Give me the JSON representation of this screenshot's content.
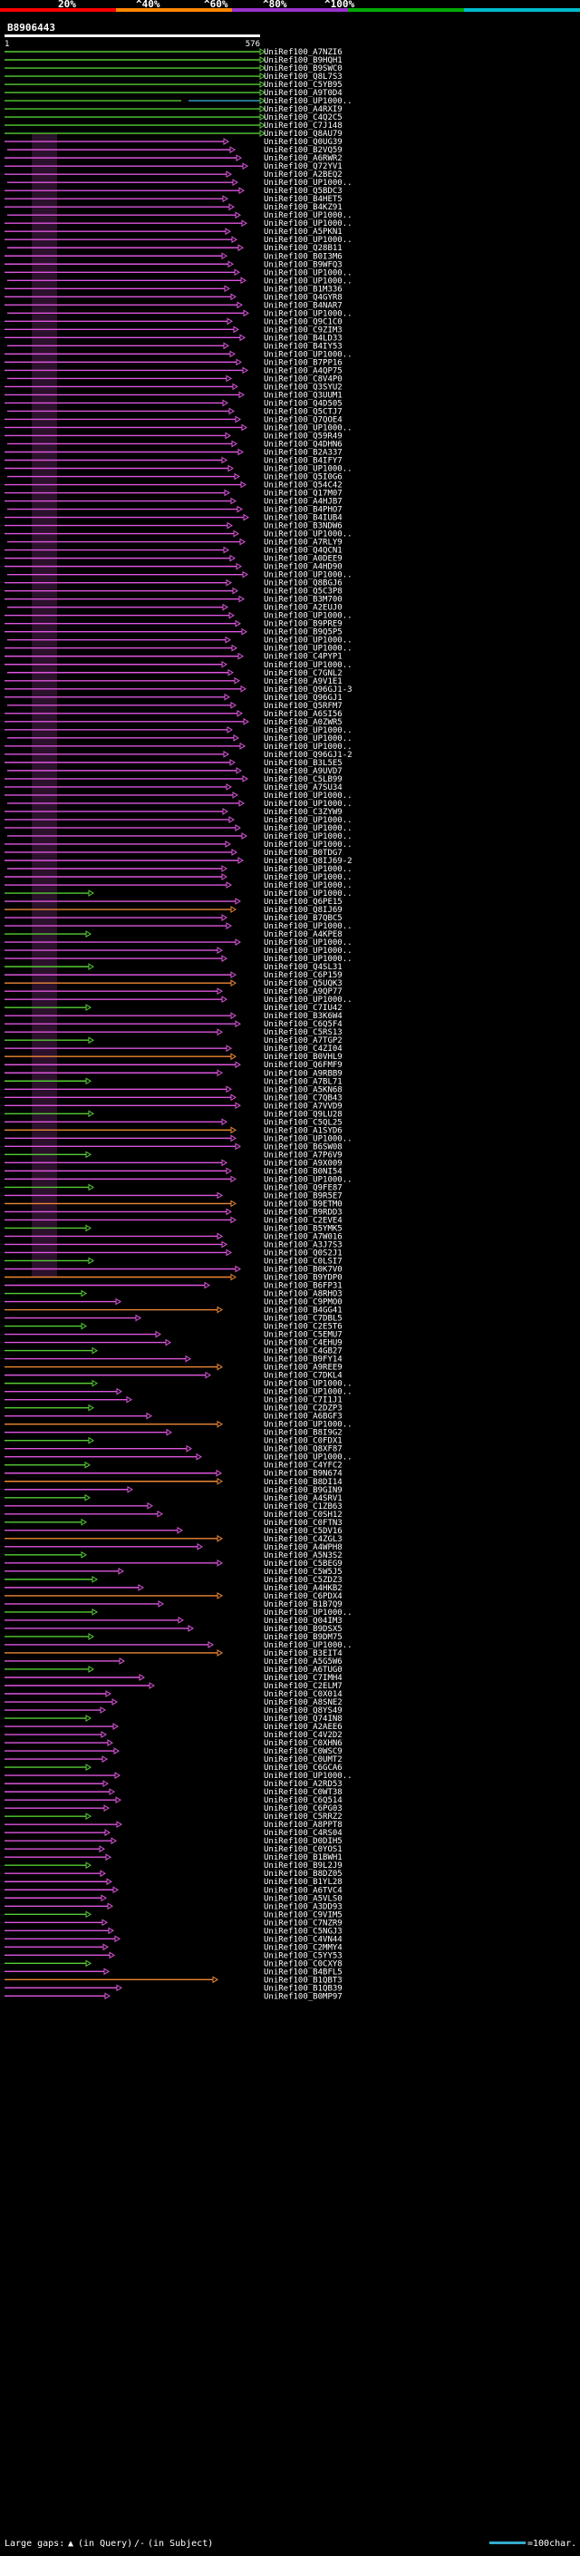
{
  "query_id": "B8906443",
  "ruler": {
    "start": "1",
    "end": "576"
  },
  "scale": {
    "ticks": [
      "20%",
      "^40%",
      "^60%",
      "^80%",
      "^100%"
    ],
    "colors": [
      "#ff0000",
      "#ff8800",
      "#9933cc",
      "#00aa00",
      "#00bbcc"
    ]
  },
  "legend": {
    "large_gaps_label": "Large gaps:",
    "in_query_label": "(in Query)",
    "in_subject_label": "(in Subject)",
    "scale_label": "=100char."
  },
  "colors": {
    "green": "#55cc33",
    "magenta": "#dd55dd",
    "orange": "#ee8833",
    "cyan": "#33aacc",
    "dark_fill": "#4a1c4a"
  },
  "hits": [
    "UniRef100_A7NZI6",
    "UniRef100_B9HQH1",
    "UniRef100_B9SWC0",
    "UniRef100_Q8L7S3",
    "UniRef100_C5YB95",
    "UniRef100_A9T0D4",
    "UniRef100_UP1000..",
    "UniRef100_A4RXI9",
    "UniRef100_C4Q2C5",
    "UniRef100_C7J148",
    "UniRef100_Q8AU79",
    "UniRef100_Q0UG39",
    "UniRef100_B2VQ59",
    "UniRef100_A6RWR2",
    "UniRef100_Q72YV1",
    "UniRef100_A2BEQ2",
    "UniRef100_UP1000..",
    "UniRef100_Q5BDC3",
    "UniRef100_B4HET5",
    "UniRef100_B4KZ91",
    "UniRef100_UP1000..",
    "UniRef100_UP1000..",
    "UniRef100_A5PKN1",
    "UniRef100_UP1000..",
    "UniRef100_Q28B11",
    "UniRef100_B0I3M6",
    "UniRef100_B9WFQ3",
    "UniRef100_UP1000..",
    "UniRef100_UP1000..",
    "UniRef100_B1M336",
    "UniRef100_Q4GYR8",
    "UniRef100_B4NAR7",
    "UniRef100_UP1000..",
    "UniRef100_Q9C1C0",
    "UniRef100_C9ZIM3",
    "UniRef100_B4LD33",
    "UniRef100_B4IY53",
    "UniRef100_UP1000..",
    "UniRef100_B7PP16",
    "UniRef100_A4QP75",
    "UniRef100_C8V4P0",
    "UniRef100_Q3SYU2",
    "UniRef100_Q3UUM1",
    "UniRef100_Q4D505",
    "UniRef100_Q5CTJ7",
    "UniRef100_Q7QOE4",
    "UniRef100_UP1000..",
    "UniRef100_Q59R49",
    "UniRef100_Q4DHN6",
    "UniRef100_B2A337",
    "UniRef100_B4IFY7",
    "UniRef100_UP1000..",
    "UniRef100_Q5I0G6",
    "UniRef100_Q54C42",
    "UniRef100_Q17M07",
    "UniRef100_A4HJB7",
    "UniRef100_B4PHO7",
    "UniRef100_B4IUB4",
    "UniRef100_B3NDW6",
    "UniRef100_UP1000..",
    "UniRef100_A7RLY9",
    "UniRef100_Q4QCN1",
    "UniRef100_A0DEE9",
    "UniRef100_A4HD90",
    "UniRef100_UP1000..",
    "UniRef100_Q8BGJ6",
    "UniRef100_Q5C3P8",
    "UniRef100_B3M700",
    "UniRef100_A2EUJ0",
    "UniRef100_UP1000..",
    "UniRef100_B9PRE9",
    "UniRef100_B9Q5P5",
    "UniRef100_UP1000..",
    "UniRef100_UP1000..",
    "UniRef100_C4PYP1",
    "UniRef100_UP1000..",
    "UniRef100_C7GNL2",
    "UniRef100_A9V1E1",
    "UniRef100_Q96GJ1-3",
    "UniRef100_Q96GJ1",
    "UniRef100_Q5RFM7",
    "UniRef100_A6SI56",
    "UniRef100_A0ZWR5",
    "UniRef100_UP1000..",
    "UniRef100_UP1000..",
    "UniRef100_UP1000..",
    "UniRef100_Q96GJ1-2",
    "UniRef100_B3L5E5",
    "UniRef100_A9UVD7",
    "UniRef100_C5LB99",
    "UniRef100_A7SU34",
    "UniRef100_UP1000..",
    "UniRef100_UP1000..",
    "UniRef100_C3ZYW9",
    "UniRef100_UP1000..",
    "UniRef100_UP1000..",
    "UniRef100_UP1000..",
    "UniRef100_UP1000..",
    "UniRef100_B0TDG7",
    "UniRef100_Q8IJ69-2",
    "UniRef100_UP1000..",
    "UniRef100_UP1000..",
    "UniRef100_UP1000..",
    "UniRef100_UP1000..",
    "UniRef100_Q6PE15",
    "UniRef100_Q8IJ69",
    "UniRef100_B7QBC5",
    "UniRef100_UP1000..",
    "UniRef100_A4KPE8",
    "UniRef100_UP1000..",
    "UniRef100_UP1000..",
    "UniRef100_UP1000..",
    "UniRef100_Q4SL31",
    "UniRef100_C6P159",
    "UniRef100_Q5UQK3",
    "UniRef100_A9QP77",
    "UniRef100_UP1000..",
    "UniRef100_C7IU42",
    "UniRef100_B3K6W4",
    "UniRef100_C6Q5F4",
    "UniRef100_C5RS13",
    "UniRef100_A7TGP2",
    "UniRef100_C4ZI04",
    "UniRef100_B0VHL9",
    "UniRef100_Q6FMF9",
    "UniRef100_A9RBB9",
    "UniRef100_A7BL71",
    "UniRef100_A5KN68",
    "UniRef100_C7QB43",
    "UniRef100_A7VVD9",
    "UniRef100_Q9LU28",
    "UniRef100_C5QL25",
    "UniRef100_A1SYD6",
    "UniRef100_UP1000..",
    "UniRef100_B6SW08",
    "UniRef100_A7P6V9",
    "UniRef100_A9X009",
    "UniRef100_B0NI54",
    "UniRef100_UP1000..",
    "UniRef100_Q9FE87",
    "UniRef100_B9R5E7",
    "UniRef100_B9ETM0",
    "UniRef100_B9RDD3",
    "UniRef100_C2EVE4",
    "UniRef100_B5YMK5",
    "UniRef100_A7W016",
    "UniRef100_A3J7S3",
    "UniRef100_Q0S2J1",
    "UniRef100_C0LSI7",
    "UniRef100_B0K7V0",
    "UniRef100_B9YDP0",
    "UniRef100_B6FP31",
    "UniRef100_A8RHO3",
    "UniRef100_C9PMO0",
    "UniRef100_B4GG41",
    "UniRef100_C7DBL5",
    "UniRef100_C2E5T6",
    "UniRef100_C5EMU7",
    "UniRef100_C4EHU9",
    "UniRef100_C4GB27",
    "UniRef100_B9FY14",
    "UniRef100_A9REE9",
    "UniRef100_C7DKL4",
    "UniRef100_UP1000..",
    "UniRef100_UP1000..",
    "UniRef100_C7I1J1",
    "UniRef100_C2DZP3",
    "UniRef100_A6BGF3",
    "UniRef100_UP1000..",
    "UniRef100_B8I9G2",
    "UniRef100_C0FDX1",
    "UniRef100_Q8XF87",
    "UniRef100_UP1000..",
    "UniRef100_C4YFC2",
    "UniRef100_B9N674",
    "UniRef100_B8DI14",
    "UniRef100_B9GIN9",
    "UniRef100_A4SRV1",
    "UniRef100_C1ZB63",
    "UniRef100_C0SH12",
    "UniRef100_C0FTN3",
    "UniRef100_C5DV16",
    "UniRef100_C4ZGL3",
    "UniRef100_A4WPH8",
    "UniRef100_A5N3S2",
    "UniRef100_C5BEG9",
    "UniRef100_C5W5J5",
    "UniRef100_C5ZDZ3",
    "UniRef100_A4HKB2",
    "UniRef100_C6PDX4",
    "UniRef100_B1B7Q9",
    "UniRef100_UP1000..",
    "UniRef100_Q04IM3",
    "UniRef100_B9DSX5",
    "UniRef100_B9DM75",
    "UniRef100_UP1000..",
    "UniRef100_B3EIT4",
    "UniRef100_A5G5W6",
    "UniRef100_A6TUG0",
    "UniRef100_C7IMH4",
    "UniRef100_C2ELM7",
    "UniRef100_C0X014",
    "UniRef100_A8SNE2",
    "UniRef100_Q8YS49",
    "UniRef100_Q74IN8",
    "UniRef100_A2AEE6",
    "UniRef100_C4V2D2",
    "UniRef100_C0XHN6",
    "UniRef100_C0WSC9",
    "UniRef100_C0UMT2",
    "UniRef100_C6GCA6",
    "UniRef100_UP1000..",
    "UniRef100_A2RD53",
    "UniRef100_C0WT38",
    "UniRef100_C6Q514",
    "UniRef100_C6PG03",
    "UniRef100_C5RRZ2",
    "UniRef100_A8PPT8",
    "UniRef100_C4RS04",
    "UniRef100_D0DIH5",
    "UniRef100_C0YOS1",
    "UniRef100_B1BWH1",
    "UniRef100_B9L2J9",
    "UniRef100_B8DZ05",
    "UniRef100_B1YL28",
    "UniRef100_A6TVC4",
    "UniRef100_A5VLS0",
    "UniRef100_A3DD93",
    "UniRef100_C9VIM5",
    "UniRef100_C7NZR9",
    "UniRef100_C5NGJ3",
    "UniRef100_C4VN44",
    "UniRef100_C2MMY4",
    "UniRef100_C5YY53",
    "UniRef100_C0CXY8",
    "UniRef100_B4BFL5",
    "UniRef100_B1QBT3",
    "UniRef100_B1QB39",
    "UniRef100_B0MP97"
  ]
}
